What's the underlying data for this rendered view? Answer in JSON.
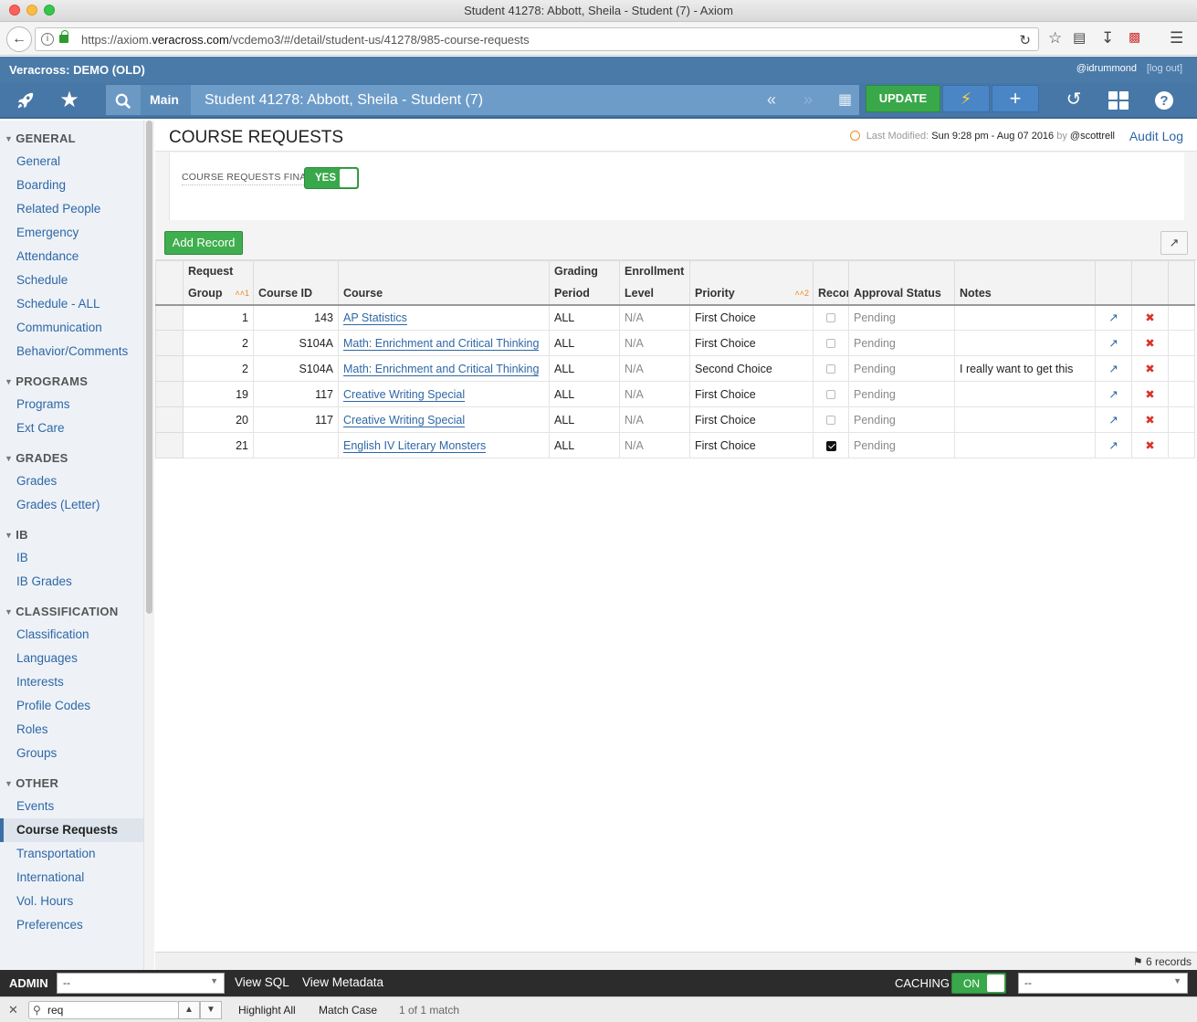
{
  "window": {
    "title": "Student 41278: Abbott, Sheila - Student (7) - Axiom"
  },
  "browser": {
    "url_prefix": "https://axiom.",
    "url_domain": "veracross.com",
    "url_path": "/vcdemo3/#/detail/student-us/41278/985-course-requests"
  },
  "app": {
    "name": "Veracross: DEMO (OLD)",
    "user": "@idrummond",
    "logout": "[log out]",
    "breadcrumb": "Main",
    "record_title": "Student 41278: Abbott, Sheila - Student (7)",
    "update_label": "UPDATE"
  },
  "sidebar": {
    "groups": [
      {
        "title": "GENERAL",
        "items": [
          "General",
          "Boarding",
          "Related People",
          "Emergency",
          "Attendance",
          "Schedule",
          "Schedule - ALL",
          "Communication",
          "Behavior/Comments"
        ]
      },
      {
        "title": "PROGRAMS",
        "items": [
          "Programs",
          "Ext Care"
        ]
      },
      {
        "title": "GRADES",
        "items": [
          "Grades",
          "Grades (Letter)"
        ]
      },
      {
        "title": "IB",
        "items": [
          "IB",
          "IB Grades"
        ]
      },
      {
        "title": "CLASSIFICATION",
        "items": [
          "Classification",
          "Languages",
          "Interests",
          "Profile Codes",
          "Roles",
          "Groups"
        ]
      },
      {
        "title": "OTHER",
        "items": [
          "Events",
          "Course Requests",
          "Transportation",
          "International",
          "Vol. Hours",
          "Preferences"
        ]
      }
    ],
    "active_item": "Course Requests"
  },
  "pane": {
    "title": "COURSE REQUESTS",
    "last_modified_label": "Last Modified:",
    "last_modified_value": "Sun 9:28 pm - Aug 07 2016",
    "by_label": "by",
    "modified_by": "@scottrell",
    "audit_log": "Audit Log",
    "field_label": "COURSE REQUESTS FINA...",
    "toggle_value": "YES",
    "add_record": "Add Record"
  },
  "grid": {
    "headers": {
      "request_group_1": "Request",
      "request_group_2": "Group",
      "request_group_sort": "1",
      "course_id": "Course ID",
      "course": "Course",
      "grading_1": "Grading",
      "grading_2": "Period",
      "enrollment_1": "Enrollment",
      "enrollment_2": "Level",
      "priority": "Priority",
      "priority_sort": "2",
      "recon": "Recon",
      "approval": "Approval Status",
      "notes": "Notes"
    },
    "rows": [
      {
        "group": "1",
        "course_id": "143",
        "course": "AP Statistics",
        "grading": "ALL",
        "enrollment": "N/A",
        "priority": "First Choice",
        "recon": false,
        "approval": "Pending",
        "notes": ""
      },
      {
        "group": "2",
        "course_id": "S104A",
        "course": "Math: Enrichment and Critical Thinking",
        "grading": "ALL",
        "enrollment": "N/A",
        "priority": "First Choice",
        "recon": false,
        "approval": "Pending",
        "notes": ""
      },
      {
        "group": "2",
        "course_id": "S104A",
        "course": "Math: Enrichment and Critical Thinking",
        "grading": "ALL",
        "enrollment": "N/A",
        "priority": "Second Choice",
        "recon": false,
        "approval": "Pending",
        "notes": "I really want to get this"
      },
      {
        "group": "19",
        "course_id": "117",
        "course": "Creative Writing Special",
        "grading": "ALL",
        "enrollment": "N/A",
        "priority": "First Choice",
        "recon": false,
        "approval": "Pending",
        "notes": ""
      },
      {
        "group": "20",
        "course_id": "117",
        "course": "Creative Writing Special",
        "grading": "ALL",
        "enrollment": "N/A",
        "priority": "First Choice",
        "recon": false,
        "approval": "Pending",
        "notes": ""
      },
      {
        "group": "21",
        "course_id": "",
        "course": "English IV Literary Monsters",
        "grading": "ALL",
        "enrollment": "N/A",
        "priority": "First Choice",
        "recon": true,
        "approval": "Pending",
        "notes": ""
      }
    ],
    "record_count": "6 records"
  },
  "admin": {
    "label": "ADMIN",
    "select_value": "--",
    "view_sql": "View SQL",
    "view_metadata": "View Metadata",
    "caching_label": "CACHING",
    "caching_value": "ON",
    "right_select_value": "--"
  },
  "findbar": {
    "query": "req",
    "highlight_all": "Highlight All",
    "match_case": "Match Case",
    "match_count": "1 of 1 match"
  },
  "colors": {
    "header_blue": "#4777a6",
    "link_blue": "#2e67a6",
    "green": "#39a84a",
    "delete_red": "#d9342b",
    "sort_orange": "#f08a24"
  }
}
